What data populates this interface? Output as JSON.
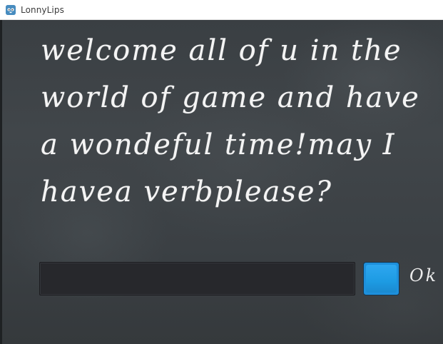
{
  "window": {
    "title": "LonnyLips",
    "app_icon": "godot-icon"
  },
  "game": {
    "prompt_text": "welcome all of u in the world of game and have a wondeful time!may I havea verbplease?",
    "input": {
      "value": "",
      "placeholder": ""
    },
    "ok_button": {
      "label": "Ok",
      "color": "#1e90dc"
    }
  }
}
